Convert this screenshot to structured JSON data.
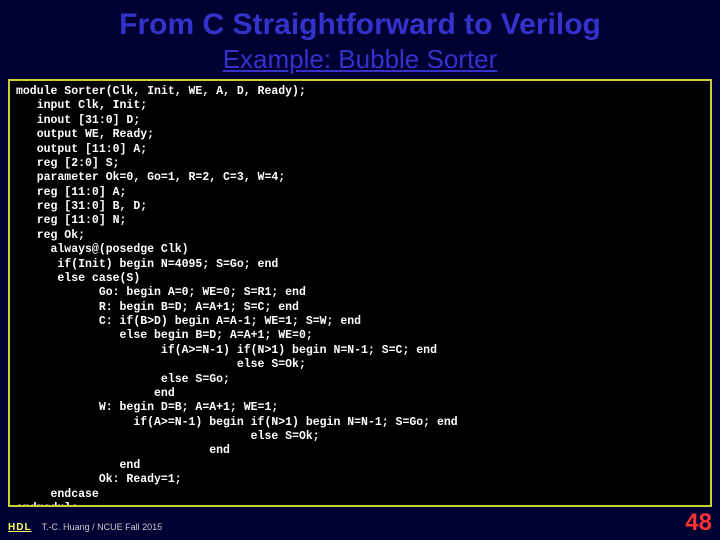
{
  "title": {
    "main": "From C Straightforward to Verilog",
    "sub": "Example: Bubble Sorter"
  },
  "code": "module Sorter(Clk, Init, WE, A, D, Ready);\n   input Clk, Init;\n   inout [31:0] D;\n   output WE, Ready;\n   output [11:0] A;\n   reg [2:0] S;\n   parameter Ok=0, Go=1, R=2, C=3, W=4;\n   reg [11:0] A;\n   reg [31:0] B, D;\n   reg [11:0] N;\n   reg Ok;\n     always@(posedge Clk)\n      if(Init) begin N=4095; S=Go; end\n      else case(S)\n            Go: begin A=0; WE=0; S=R1; end\n            R: begin B=D; A=A+1; S=C; end\n            C: if(B>D) begin A=A-1; WE=1; S=W; end\n               else begin B=D; A=A+1; WE=0;\n                     if(A>=N-1) if(N>1) begin N=N-1; S=C; end\n                                else S=Ok;\n                     else S=Go;\n                    end\n            W: begin D=B; A=A+1; WE=1;\n                 if(A>=N-1) begin if(N>1) begin N=N-1; S=Go; end\n                                  else S=Ok;\n                            end\n               end\n            Ok: Ready=1;\n     endcase\nendmodule",
  "footer": {
    "tag": "HDL",
    "author": "T.-C. Huang / NCUE Fall 2015",
    "page": "48"
  }
}
